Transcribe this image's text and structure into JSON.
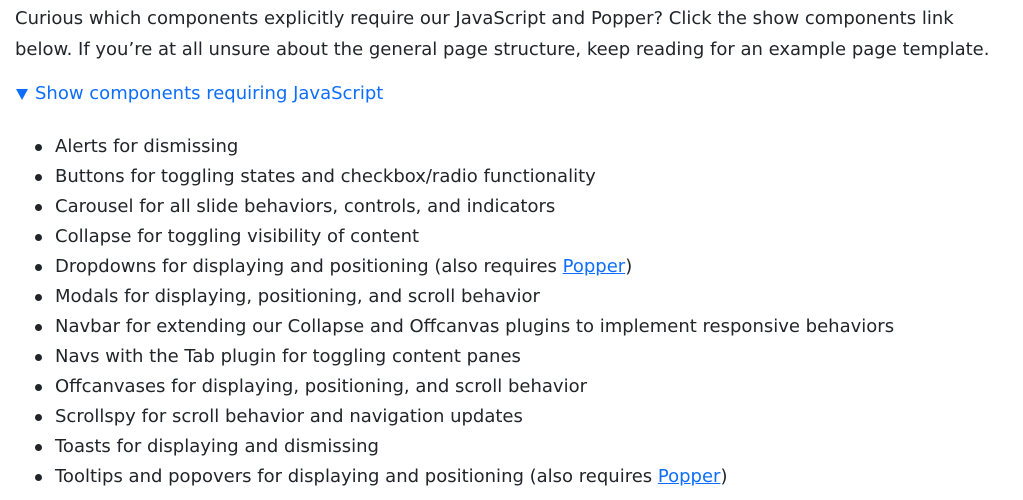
{
  "intro": {
    "line1": "Curious which components explicitly require our JavaScript and Popper? Click the show components link",
    "line2": "below. If you’re at all unsure about the general page structure, keep reading for an example page template."
  },
  "details": {
    "summary_label": "Show components requiring JavaScript"
  },
  "components": [
    {
      "text": "Alerts for dismissing"
    },
    {
      "text": "Buttons for toggling states and checkbox/radio functionality"
    },
    {
      "text": "Carousel for all slide behaviors, controls, and indicators"
    },
    {
      "text": "Collapse for toggling visibility of content"
    },
    {
      "text": "Dropdowns for displaying and positioning (also requires ",
      "link": "Popper",
      "suffix": ")"
    },
    {
      "text": "Modals for displaying, positioning, and scroll behavior"
    },
    {
      "text": "Navbar for extending our Collapse and Offcanvas plugins to implement responsive behaviors"
    },
    {
      "text": "Navs with the Tab plugin for toggling content panes"
    },
    {
      "text": "Offcanvases for displaying, positioning, and scroll behavior"
    },
    {
      "text": "Scrollspy for scroll behavior and navigation updates"
    },
    {
      "text": "Toasts for displaying and dismissing"
    },
    {
      "text": "Tooltips and popovers for displaying and positioning (also requires ",
      "link": "Popper",
      "suffix": ")"
    }
  ],
  "colors": {
    "link": "#0d6efd",
    "text": "#212529"
  }
}
